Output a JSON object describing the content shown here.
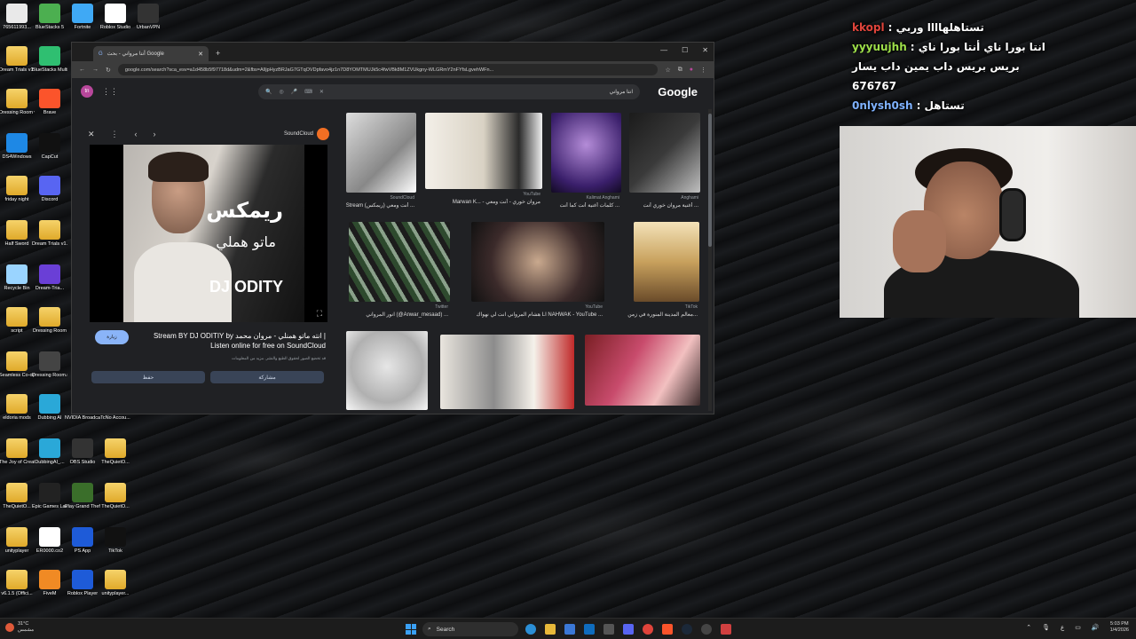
{
  "desktop": {
    "icons": [
      {
        "label": "765611993..."
      },
      {
        "label": "BlueStacks 5"
      },
      {
        "label": "Fortnite"
      },
      {
        "label": "Roblox Studio"
      },
      {
        "label": "UrbanVPN"
      },
      {
        "label": "Dream Trials v1.0.1"
      },
      {
        "label": "BlueStacks Multi-Insta..."
      },
      {
        "label": "Dressing Room v1.3"
      },
      {
        "label": "Brave"
      },
      {
        "label": "DS4Windows"
      },
      {
        "label": "CapCut"
      },
      {
        "label": "friday night"
      },
      {
        "label": "Discord"
      },
      {
        "label": "Half Sword"
      },
      {
        "label": "Dream Trials v1.0.1.zip"
      },
      {
        "label": "Recycle Bin"
      },
      {
        "label": "Dream-Tria..."
      },
      {
        "label": "script"
      },
      {
        "label": "Dressing Room"
      },
      {
        "label": "Seamless Co-op v1.9..."
      },
      {
        "label": "Dressing Room.rar"
      },
      {
        "label": "eldoria mods"
      },
      {
        "label": "Dubbing AI"
      },
      {
        "label": "NVIDIA Broadcast"
      },
      {
        "label": "TcNo Accou..."
      },
      {
        "label": "The Joy of Creation..."
      },
      {
        "label": "DubbingAI_..."
      },
      {
        "label": "OBS Studio"
      },
      {
        "label": "TheQuietO..."
      },
      {
        "label": "TheQuietO..."
      },
      {
        "label": "Epic Games Launcher"
      },
      {
        "label": "Play Grand Theft Auto..."
      },
      {
        "label": "TheQuietO..."
      },
      {
        "label": "unityplayer"
      },
      {
        "label": "ER0000.co2"
      },
      {
        "label": "PS App"
      },
      {
        "label": "TikTok"
      },
      {
        "label": "v6.1.5 (Offici..."
      },
      {
        "label": "FiveM"
      },
      {
        "label": "Roblox Player"
      },
      {
        "label": "unityplayer..."
      }
    ]
  },
  "browser": {
    "tab_title": "أنتا مرواني - بحث Google",
    "url": "google.com/search?sca_esv=a1d458b5f97718d&udm=2&fbs=AIljpHyzBRJaG7GTqOVDpfavo4jz1n7D8YOMTMUJk5c4fwVBk8M1ZVUkgny-WLGRmY2nFYfsLgvehWFn...",
    "avatar_initials": "tn",
    "search_query": "انتا مرواني",
    "google_logo": "Google",
    "panel": {
      "source": "SoundCloud",
      "art_text_1": "ريمكس",
      "art_text_2": "ماتو هملي",
      "art_text_3": "DJ ODITY",
      "visit_label": "زيارة",
      "title": "Stream BY DJ ODITIY by انته ماتو همنلي - مروان محمد | Listen online for free on SoundCloud",
      "description": "قد تخضع الصور لحقوق الطبع والنشر. مزيد من المعلومات",
      "share_label": "مشاركة",
      "save_label": "حفظ"
    },
    "results": [
      {
        "source": "SoundCloud",
        "title": "Stream (ريمكس) أنت ومعي ..."
      },
      {
        "source": "YouTube",
        "title": "Marwan K... - مروان خوري - أنت ومعي"
      },
      {
        "source": "Kalimat Anghami",
        "title": "كلمات أغنية أنت كما أنت ..."
      },
      {
        "source": "Anghami",
        "title": "أغنية مروان خوري أنت ..."
      },
      {
        "source": "Twitter",
        "title": "انور المرواني (@Anwar_mesaad) ..."
      },
      {
        "source": "YouTube",
        "title": "هشام المرواني انت لي نهواك LI NAHWAK - YouTube ..."
      },
      {
        "source": "TikTok",
        "title": "معالم المدينة المنورة في زمن..."
      }
    ]
  },
  "chat": [
    {
      "user": "kkopl",
      "user_color": "#e0443b",
      "message": "تستاهلهاااا وربي"
    },
    {
      "user": "yyyuujhh",
      "user_color": "#9ee04a",
      "message": "انتا بورا ناي أنتا بورا ناي"
    },
    {
      "user": "",
      "user_color": "#ffffff",
      "message": "بريس بريس داب يمين داب يسار"
    },
    {
      "user": "",
      "user_color": "#ffffff",
      "message": "676767"
    },
    {
      "user": "0nlysh0sh",
      "user_color": "#7fb2ff",
      "message": "تستاهل"
    }
  ],
  "taskbar": {
    "weather_temp": "31°C",
    "weather_desc": "مشمس",
    "search_placeholder": "Search",
    "lang": "ع",
    "time": "5:03 PM",
    "date": "1/4/2026"
  }
}
